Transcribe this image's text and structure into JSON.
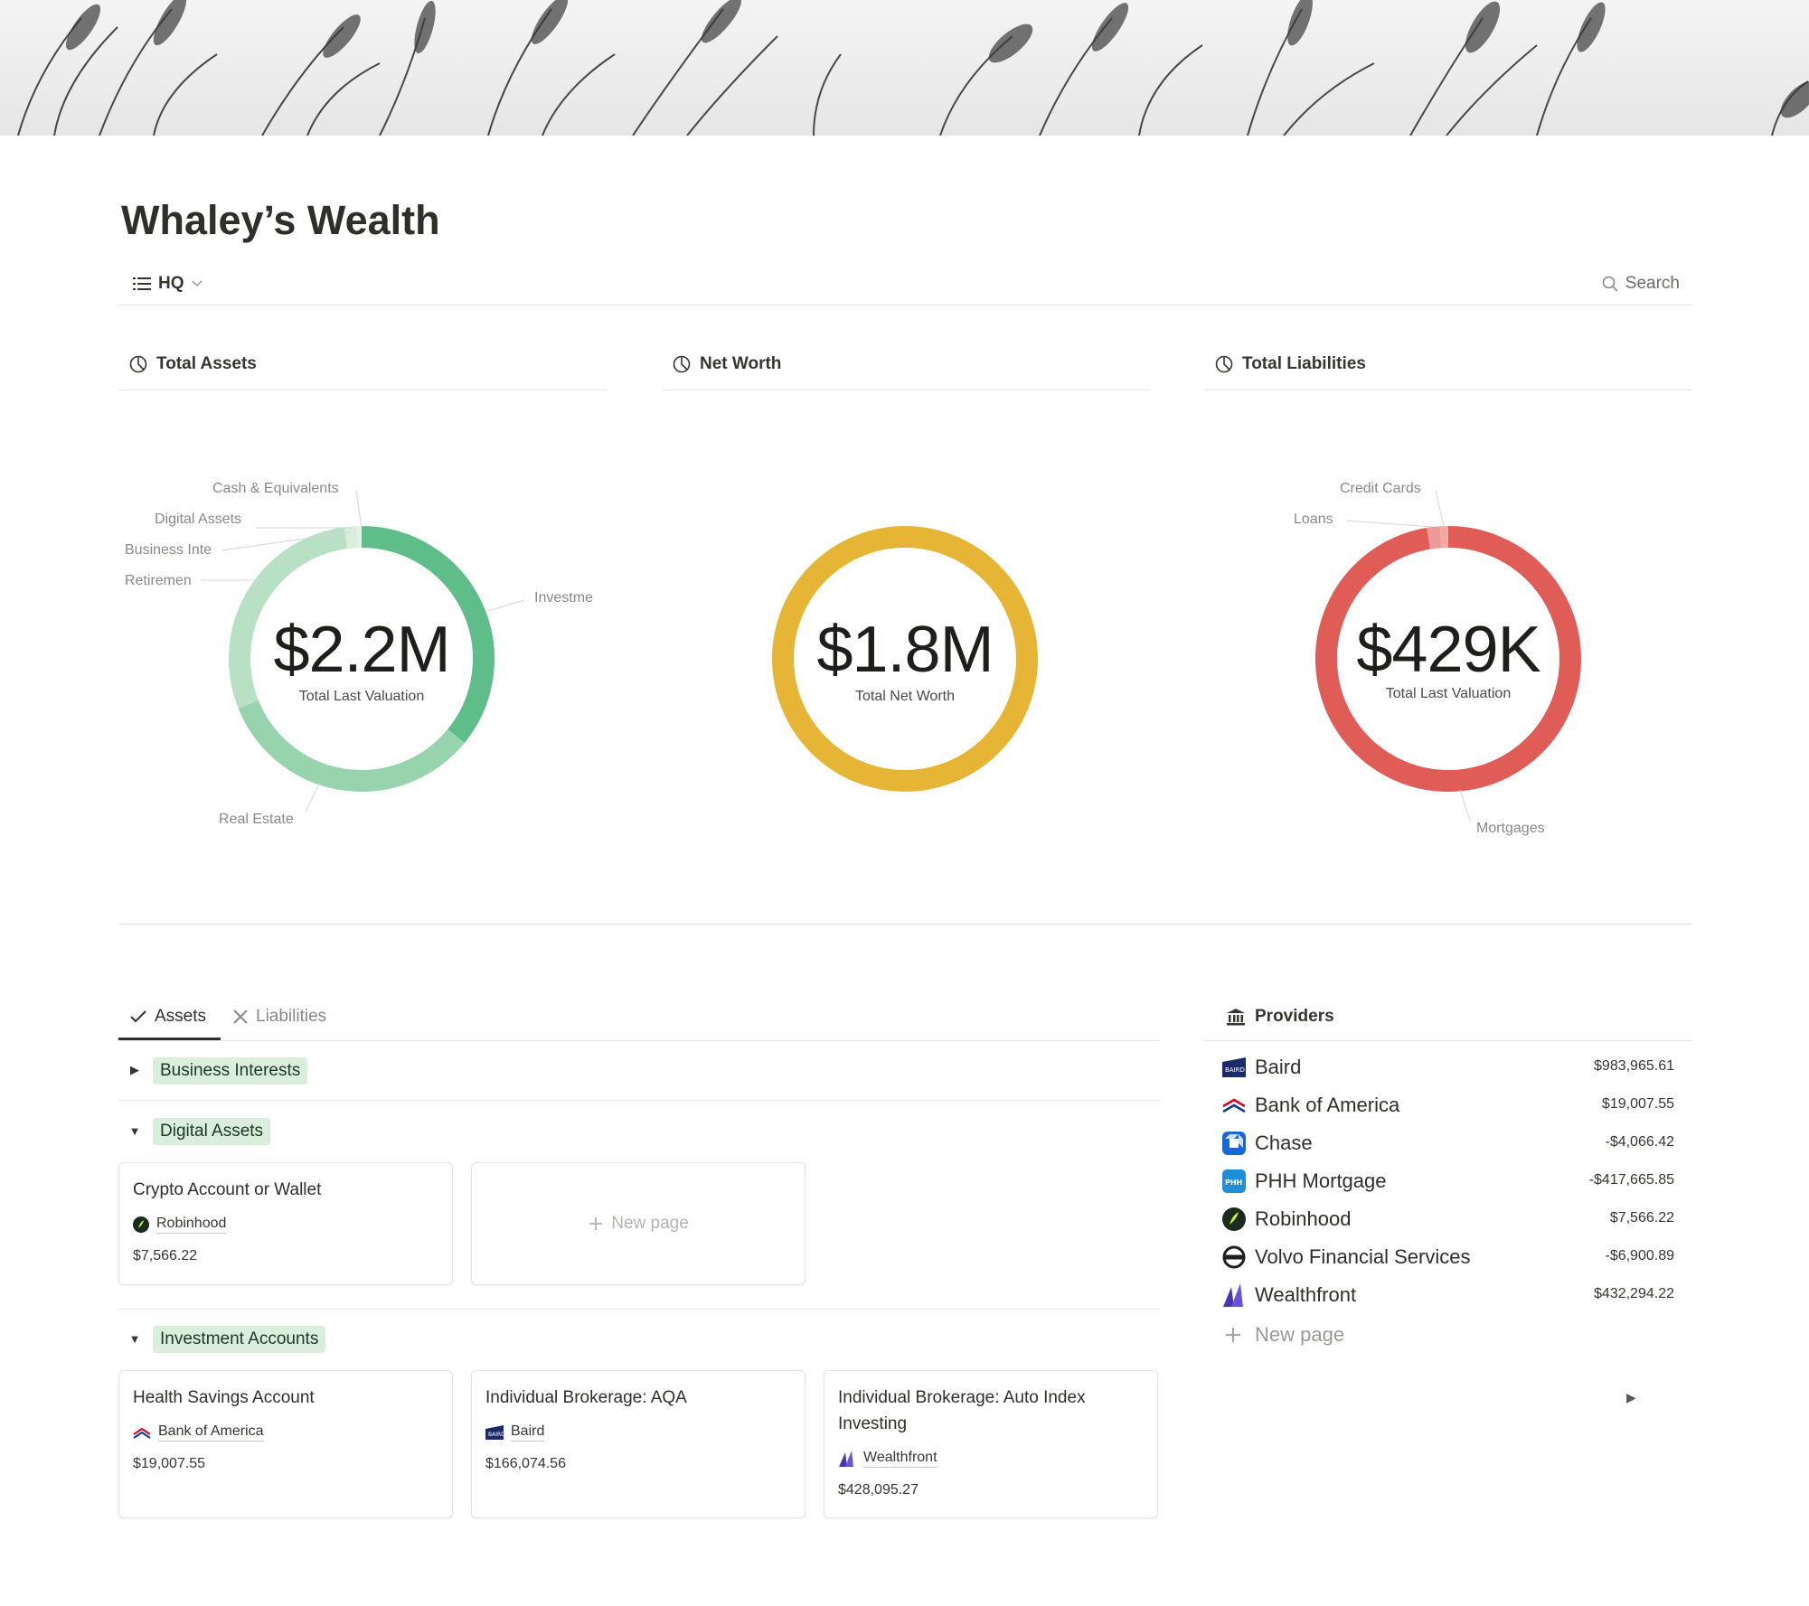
{
  "page": {
    "title": "Whaley’s Wealth"
  },
  "viewbar": {
    "view_label": "HQ",
    "search_label": "Search"
  },
  "charts": {
    "assets": {
      "header": "Total Assets",
      "value": "$2.2M",
      "sublabel": "Total Last Valuation",
      "labels": {
        "cash": "Cash & Equivalents",
        "digital": "Digital Assets",
        "business": "Business Inte",
        "retirement": "Retiremen",
        "investments": "Investme",
        "real_estate": "Real Estate"
      }
    },
    "networth": {
      "header": "Net Worth",
      "value": "$1.8M",
      "sublabel": "Total Net Worth"
    },
    "liabilities": {
      "header": "Total Liabilities",
      "value": "$429K",
      "sublabel": "Total Last Valuation",
      "labels": {
        "credit_cards": "Credit Cards",
        "loans": "Loans",
        "mortgages": "Mortgages"
      }
    }
  },
  "chart_data": [
    {
      "type": "pie",
      "title": "Total Assets",
      "center_value": "$2.2M",
      "center_label": "Total Last Valuation",
      "categories": [
        "Cash & Equivalents",
        "Digital Assets",
        "Business Interests",
        "Retirement",
        "Real Estate",
        "Investments"
      ],
      "shares": [
        0.006,
        0.014,
        0.001,
        0.29,
        0.33,
        0.359
      ],
      "colors": [
        "#e2f2e6",
        "#d9eedd",
        "#cfe9d5",
        "#b7e0c4",
        "#97d4ae",
        "#5fbd8a"
      ]
    },
    {
      "type": "pie",
      "title": "Net Worth",
      "center_value": "$1.8M",
      "center_label": "Total Net Worth",
      "categories": [
        "Net Worth"
      ],
      "shares": [
        1.0
      ],
      "colors": [
        "#e7b535"
      ]
    },
    {
      "type": "pie",
      "title": "Total Liabilities",
      "center_value": "$429K",
      "center_label": "Total Last Valuation",
      "categories": [
        "Credit Cards",
        "Loans",
        "Mortgages"
      ],
      "shares": [
        0.01,
        0.016,
        0.974
      ],
      "colors": [
        "#f1a9a4",
        "#ec9a95",
        "#e05d57"
      ]
    }
  ],
  "tabs": {
    "assets": "Assets",
    "liabilities": "Liabilities"
  },
  "groups": {
    "business": "Business Interests",
    "digital": "Digital Assets",
    "investment": "Investment Accounts"
  },
  "cards": {
    "crypto": {
      "title": "Crypto Account or Wallet",
      "provider": "Robinhood",
      "amount": "$7,566.22"
    },
    "new_page": "New page",
    "hsa": {
      "title": "Health Savings Account",
      "provider": "Bank of America",
      "amount": "$19,007.55"
    },
    "aqa": {
      "title": "Individual Brokerage: AQA",
      "provider": "Baird",
      "amount": "$166,074.56"
    },
    "auto": {
      "title": "Individual Brokerage: Auto Index Investing",
      "provider": "Wealthfront",
      "amount": "$428,095.27"
    }
  },
  "providers": {
    "header": "Providers",
    "items": [
      {
        "name": "Baird",
        "amount": "$983,965.61",
        "icon": "baird-logo"
      },
      {
        "name": "Bank of America",
        "amount": "$19,007.55",
        "icon": "bank-of-america-logo"
      },
      {
        "name": "Chase",
        "amount": "-$4,066.42",
        "icon": "chase-logo"
      },
      {
        "name": "PHH Mortgage",
        "amount": "-$417,665.85",
        "icon": "phh-logo"
      },
      {
        "name": "Robinhood",
        "amount": "$7,566.22",
        "icon": "robinhood-logo"
      },
      {
        "name": "Volvo Financial Services",
        "amount": "-$6,900.89",
        "icon": "volvo-logo"
      },
      {
        "name": "Wealthfront",
        "amount": "$432,294.22",
        "icon": "wealthfront-logo"
      }
    ],
    "new_page": "New page"
  }
}
